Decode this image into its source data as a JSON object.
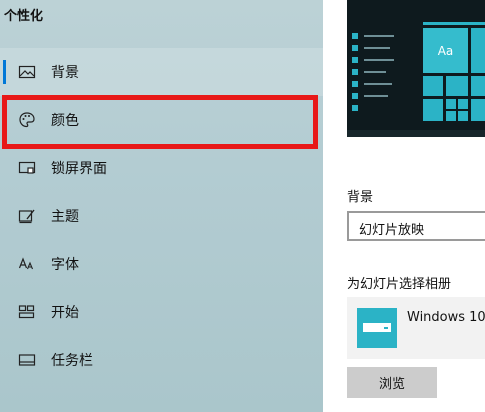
{
  "sidebar": {
    "title": "个性化",
    "items": [
      {
        "label": "背景",
        "icon": "picture-icon"
      },
      {
        "label": "颜色",
        "icon": "palette-icon"
      },
      {
        "label": "锁屏界面",
        "icon": "lock-screen-icon"
      },
      {
        "label": "主题",
        "icon": "theme-icon"
      },
      {
        "label": "字体",
        "icon": "font-icon"
      },
      {
        "label": "开始",
        "icon": "start-icon"
      },
      {
        "label": "任务栏",
        "icon": "taskbar-icon"
      }
    ],
    "selected_index": 0,
    "highlighted_index": 1
  },
  "main": {
    "preview": {
      "tile_label": "Aa"
    },
    "background_label": "背景",
    "background_value": "幻灯片放映",
    "album_label": "为幻灯片选择相册",
    "album_name": "Windows 10",
    "browse_label": "浏览"
  },
  "colors": {
    "accent": "#0078d7",
    "tile": "#2bb3c6",
    "highlight_border": "#e81818",
    "preview_bg": "#0e1a1e"
  }
}
